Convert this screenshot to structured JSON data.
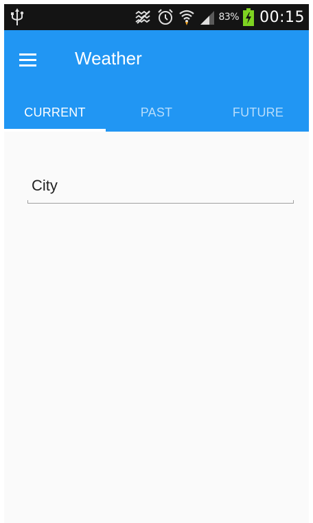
{
  "status_bar": {
    "battery_percent": "83%",
    "time": "00:15",
    "icons": [
      "usb-icon",
      "mute-icon",
      "alarm-icon",
      "wifi-icon",
      "signal-icon",
      "battery-charging-icon"
    ]
  },
  "app_bar": {
    "title": "Weather",
    "menu_icon": "hamburger-menu-icon",
    "color": "#2196f3"
  },
  "tabs": [
    {
      "label": "CURRENT",
      "active": true
    },
    {
      "label": "PAST",
      "active": false
    },
    {
      "label": "FUTURE",
      "active": false
    }
  ],
  "form": {
    "city_field": {
      "placeholder": "City",
      "value": ""
    }
  }
}
